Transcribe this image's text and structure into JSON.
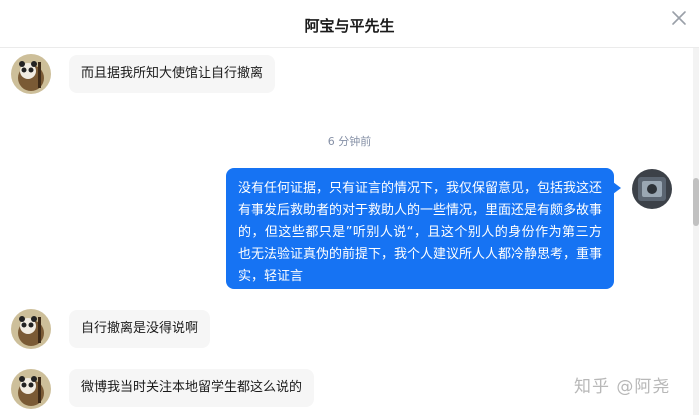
{
  "header": {
    "title": "阿宝与平先生"
  },
  "messages": [
    {
      "side": "incoming",
      "text": "而且据我所知大使馆让自行撤离"
    },
    {
      "side": "outgoing",
      "text": "没有任何证据，只有证言的情况下，我仅保留意见，包括我这还有事发后救助者的对于救助人的一些情况，里面还是有颇多故事的，但这些都只是”听别人说“，且这个别人的身份作为第三方也无法验证真伪的前提下，我个人建议所人人都冷静思考，重事实，轻证言"
    },
    {
      "side": "incoming",
      "text": "自行撤离是没得说啊"
    },
    {
      "side": "incoming",
      "text": "微博我当时关注本地留学生都这么说的"
    }
  ],
  "timestamp": "6 分钟前",
  "watermark": "知乎 @阿尧",
  "colors": {
    "outgoing_bubble": "#1673f3",
    "incoming_bubble": "#f6f6f6"
  },
  "icons": {
    "close": "close-icon",
    "contact_avatar": "panda-avatar-icon",
    "user_avatar": "user-avatar-icon"
  }
}
